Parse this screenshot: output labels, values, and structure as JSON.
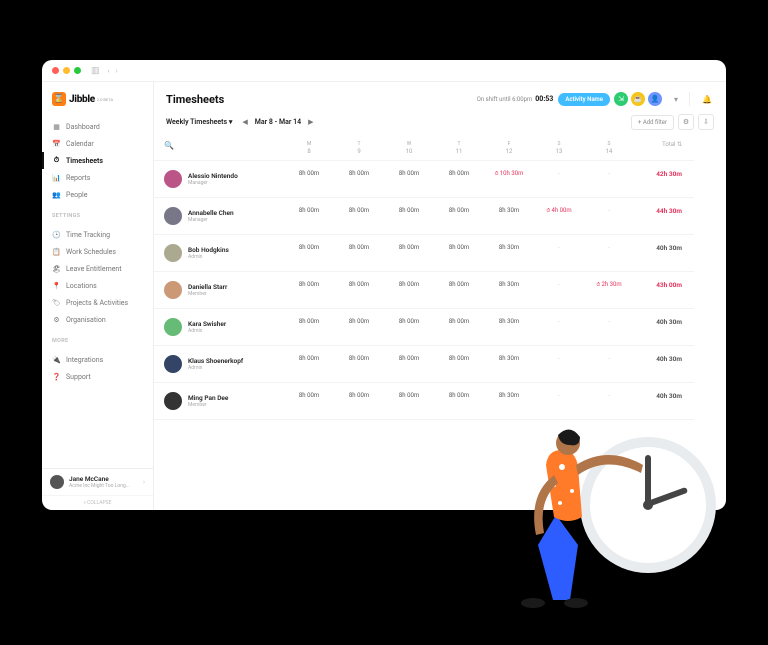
{
  "brand": {
    "name": "Jibble",
    "beta": "2.0 BETA"
  },
  "page_title": "Timesheets",
  "shift_status": "On shift until 6:00pm",
  "shift_timer": "00:53",
  "activity_pill": "Activity Name",
  "nav": {
    "main": [
      {
        "label": "Dashboard",
        "icon": "dashboard-icon"
      },
      {
        "label": "Calendar",
        "icon": "calendar-icon"
      },
      {
        "label": "Timesheets",
        "icon": "timesheet-icon",
        "active": true
      },
      {
        "label": "Reports",
        "icon": "reports-icon"
      },
      {
        "label": "People",
        "icon": "people-icon"
      }
    ],
    "settings_label": "SETTINGS",
    "settings": [
      {
        "label": "Time Tracking",
        "icon": "clock-icon"
      },
      {
        "label": "Work Schedules",
        "icon": "schedule-icon"
      },
      {
        "label": "Leave Entitlement",
        "icon": "leave-icon"
      },
      {
        "label": "Locations",
        "icon": "pin-icon"
      },
      {
        "label": "Projects & Activities",
        "icon": "tag-icon"
      },
      {
        "label": "Organisation",
        "icon": "org-icon"
      }
    ],
    "more_label": "MORE",
    "more": [
      {
        "label": "Integrations",
        "icon": "integrations-icon"
      },
      {
        "label": "Support",
        "icon": "support-icon"
      }
    ]
  },
  "user": {
    "name": "Jane McCane",
    "org": "Acme Inc Might Too Long..."
  },
  "collapse_label": "COLLAPSE",
  "toolbar": {
    "period": "Weekly Timesheets",
    "range": "Mar 8 - Mar 14",
    "add_filter": "+ Add filter"
  },
  "columns": [
    {
      "day": "M",
      "num": "8"
    },
    {
      "day": "T",
      "num": "9"
    },
    {
      "day": "W",
      "num": "10"
    },
    {
      "day": "T",
      "num": "11"
    },
    {
      "day": "F",
      "num": "12"
    },
    {
      "day": "S",
      "num": "13"
    },
    {
      "day": "S",
      "num": "14"
    }
  ],
  "total_label": "Total",
  "rows": [
    {
      "name": "Alessio Nintendo",
      "role": "Manager",
      "cells": [
        "8h 00m",
        "8h 00m",
        "8h 00m",
        "8h 00m",
        {
          "v": "10h 30m",
          "ovt": true
        },
        "-",
        "-"
      ],
      "total": "42h 30m",
      "total_red": true,
      "avatar": "#b58"
    },
    {
      "name": "Annabelle Chen",
      "role": "Manager",
      "cells": [
        "8h 00m",
        "8h 00m",
        "8h 00m",
        "8h 00m",
        "8h 30m",
        {
          "v": "4h 00m",
          "ovt": true
        },
        "-"
      ],
      "total": "44h 30m",
      "total_red": true,
      "avatar": "#778"
    },
    {
      "name": "Bob Hodgkins",
      "role": "Admin",
      "cells": [
        "8h 00m",
        "8h 00m",
        "8h 00m",
        "8h 00m",
        "8h 30m",
        "-",
        "-"
      ],
      "total": "40h 30m",
      "avatar": "#aba98f"
    },
    {
      "name": "Daniella Starr",
      "role": "Member",
      "cells": [
        "8h 00m",
        "8h 00m",
        "8h 00m",
        "8h 00m",
        "8h 30m",
        "-",
        {
          "v": "2h 30m",
          "ovt": true
        }
      ],
      "total": "43h 00m",
      "total_red": true,
      "avatar": "#c97"
    },
    {
      "name": "Kara Swisher",
      "role": "Admin",
      "cells": [
        "8h 00m",
        "8h 00m",
        "8h 00m",
        "8h 00m",
        "8h 30m",
        "-",
        "-"
      ],
      "total": "40h 30m",
      "avatar": "#6b7"
    },
    {
      "name": "Klaus Shoenerkopf",
      "role": "Admin",
      "cells": [
        "8h 00m",
        "8h 00m",
        "8h 00m",
        "8h 00m",
        "8h 30m",
        "-",
        "-"
      ],
      "total": "40h 30m",
      "avatar": "#346"
    },
    {
      "name": "Ming Pan Dee",
      "role": "Member",
      "cells": [
        "8h 00m",
        "8h 00m",
        "8h 00m",
        "8h 00m",
        "8h 30m",
        "-",
        "-"
      ],
      "total": "40h 30m",
      "avatar": "#333"
    }
  ]
}
